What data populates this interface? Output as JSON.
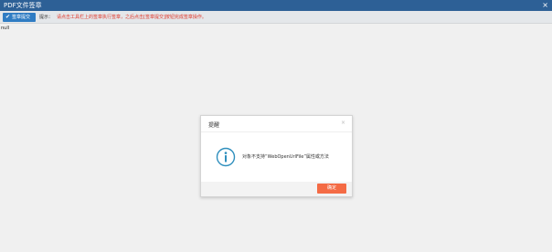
{
  "window": {
    "title": "PDF文件签章",
    "close_glyph": "×"
  },
  "toolbar": {
    "sign_button_label": "签章提交",
    "tip_label": "提示：",
    "tip_text": "请点击工具栏上的签章执行签章，之后点击[签章提交]按钮完成签章操作。"
  },
  "content": {
    "null_text": "null"
  },
  "dialog": {
    "title": "提醒",
    "close_glyph": "×",
    "message": "对象不支持“WebOpenUrlFile”属性或方法",
    "ok_label": "确定",
    "icon": "info-icon"
  },
  "colors": {
    "titlebar": "#2d6096",
    "sign_button": "#2f7cc3",
    "tip_text": "#e0372a",
    "ok_button": "#f46b45",
    "info_icon": "#2f8fbd"
  }
}
